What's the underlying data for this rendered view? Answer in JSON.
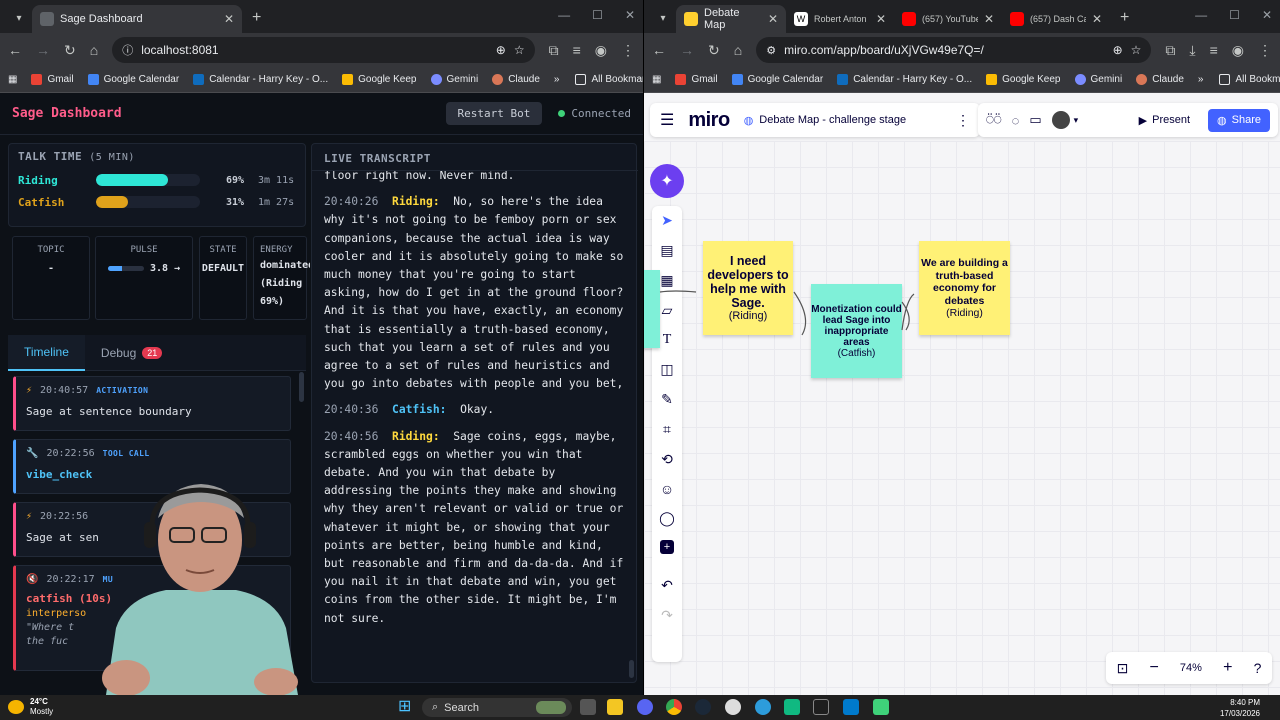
{
  "left_browser": {
    "tab": {
      "title": "Sage Dashboard"
    },
    "url": "localhost:8081",
    "bookmarks": [
      "Gmail",
      "Google Calendar",
      "Calendar - Harry Key - O...",
      "Google Keep",
      "Gemini",
      "Claude"
    ],
    "all_bookmarks": "All Bookmarks"
  },
  "dashboard": {
    "title": "Sage Dashboard",
    "restart_label": "Restart Bot",
    "status": "Connected",
    "talk_time": {
      "title": "TALK TIME",
      "window": "(5 MIN)",
      "speakers": [
        {
          "name": "Riding",
          "percent_label": "69%",
          "percent": 0.69,
          "duration": "3m 11s",
          "color": "#2ee6d6"
        },
        {
          "name": "Catfish",
          "percent_label": "31%",
          "percent": 0.31,
          "duration": "1m 27s",
          "color": "#e0a21b"
        }
      ]
    },
    "stats": {
      "topic": {
        "label": "TOPIC",
        "value": "-"
      },
      "pulse": {
        "label": "PULSE",
        "value": "3.8 →",
        "level": 0.38
      },
      "state": {
        "label": "STATE",
        "value": "DEFAULT"
      },
      "energy": {
        "label": "ENERGY",
        "value": "dominated (Riding 69%)"
      }
    },
    "tabs": {
      "timeline": "Timeline",
      "debug": "Debug",
      "debug_count": "21"
    },
    "events": [
      {
        "time": "20:40:57",
        "kind": "ACTIVATION",
        "text": "Sage at sentence boundary"
      },
      {
        "time": "20:22:56",
        "kind": "TOOL CALL",
        "text": "vibe_check"
      },
      {
        "time": "20:22:56",
        "kind": "",
        "text": "Sage at sen"
      },
      {
        "time": "20:22:17",
        "kind": "MU",
        "text": "catfish (10s)",
        "sub": "interperso",
        "quote": "\"Where t",
        "quote2": "the fuc"
      }
    ],
    "transcript": {
      "title": "LIVE TRANSCRIPT",
      "lines": [
        {
          "time": "",
          "speaker": "",
          "text": "floor right now. Never mind."
        },
        {
          "time": "20:40:26",
          "speaker": "Riding:",
          "text": "No, so here's the idea why it's not going to be femboy porn or sex companions, because the actual idea is way cooler and it is absolutely going to make so much money that you're going to start asking, how do I get in at the ground floor? And it is that you have, exactly, an economy that is essentially a truth-based economy, such that you learn a set of rules and you agree to a set of rules and heuristics and you go into debates with people and you bet,"
        },
        {
          "time": "20:40:36",
          "speaker": "Catfish:",
          "text": "Okay."
        },
        {
          "time": "20:40:56",
          "speaker": "Riding:",
          "text": "Sage coins, eggs, maybe, scrambled eggs on whether you win that debate. And you win that debate by addressing the points they make and showing why they aren't relevant or valid or true or whatever it might be, or showing that your points are better, being humble and kind, but reasonable and firm and da-da-da. And if you nail it in that debate and win, you get coins from the other side. It might be, I'm not sure."
        }
      ]
    }
  },
  "right_browser": {
    "tabs": [
      "Debate Map",
      "Robert Anton",
      "(657) YouTube",
      "(657) Dash Ca"
    ],
    "url": "miro.com/app/board/uXjVGw49e7Q=/",
    "bookmarks": [
      "Gmail",
      "Google Calendar",
      "Calendar - Harry Key - O...",
      "Google Keep",
      "Gemini",
      "Claude"
    ],
    "all_bookmarks": "All Bookmarks"
  },
  "miro": {
    "logo": "miro",
    "board_name": "Debate Map - challenge stage",
    "present_label": "Present",
    "share_label": "Share",
    "zoom": "74%",
    "stickies": [
      {
        "text": "I need developers to help me with Sage.",
        "author": "(Riding)",
        "color": "#fff176"
      },
      {
        "text": "Monetization could lead Sage into inappropriate areas",
        "author": "(Catfish)",
        "color": "#7ff0d8"
      },
      {
        "text": "We are building a truth-based economy for debates",
        "author": "(Riding)",
        "color": "#fff176"
      }
    ]
  },
  "taskbar": {
    "temp": "24°C",
    "weather": "Mostly",
    "search": "Search",
    "time": "8:40 PM",
    "date": "17/03/2026"
  }
}
